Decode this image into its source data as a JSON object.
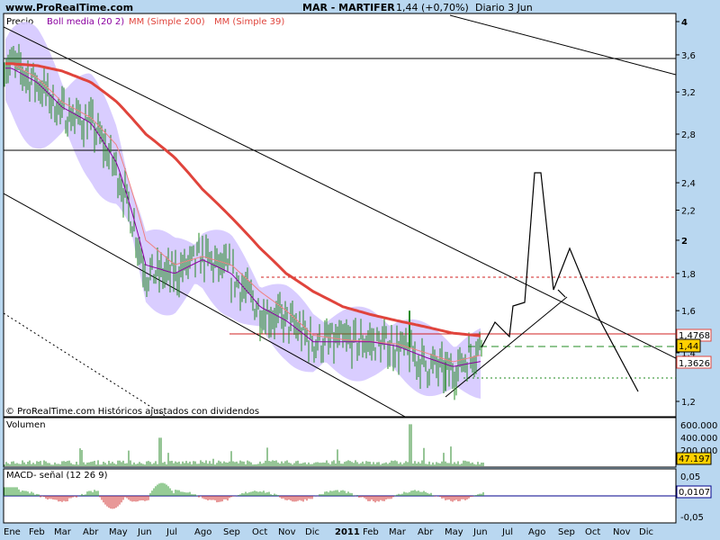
{
  "header": {
    "site": "www.ProRealTime.com",
    "instrument": "MAR - MARTIFER",
    "price_change": "1,44 (+0,70%)",
    "period": "Diario  3 Jun"
  },
  "price_panel": {
    "legend": {
      "precio": "Precio",
      "boll": "Boll media (20 2)",
      "mm200": "MM (Simple 200)",
      "mm39": "MM (Simple 39)"
    },
    "footer_note": "© ProRealTime.com Históricos ajustados con dividendos",
    "y_ticks": [
      "4",
      "3,6",
      "3,2",
      "2,8",
      "2,4",
      "2,2",
      "2",
      "1,8",
      "1,6",
      "1,4",
      "1,2"
    ],
    "price_tags": {
      "mm_value": "1,4768",
      "last": "1,44",
      "boll_value": "1,3626"
    }
  },
  "volume_panel": {
    "label": "Volumen",
    "y_ticks": [
      "600.000",
      "400.000",
      "200.000"
    ],
    "value_tag": "47.197"
  },
  "macd_panel": {
    "label": "MACD- señal (12 26 9)",
    "y_ticks": [
      "0,05",
      "-0,05"
    ],
    "value_tag": "0,0107"
  },
  "x_axis": {
    "labels": [
      "Ene",
      "Feb",
      "Mar",
      "Abr",
      "May",
      "Jun",
      "Jul",
      "Ago",
      "Sep",
      "Oct",
      "Nov",
      "Dic",
      "2011",
      "Feb",
      "Mar",
      "Abr",
      "May",
      "Jun",
      "Jul",
      "Ago",
      "Sep",
      "Oct",
      "Nov",
      "Dic"
    ]
  },
  "colors": {
    "background": "#b9d7f0",
    "plot_bg": "#ffffff",
    "price_bars": "#228b22",
    "bollinger_fill": "#d5c8ff",
    "mm200": "#e0443c",
    "mm39": "#f08080",
    "boll_mid": "#8b00a0",
    "volume_bars": "#2e8b2e",
    "macd_pos": "#2e9a2e",
    "macd_neg": "#d03030",
    "signal_line": "#00008b",
    "last_tag": "#ffd000"
  },
  "chart_data": [
    {
      "type": "line",
      "title": "MAR - MARTIFER",
      "x": [
        "Ene",
        "Feb",
        "Mar",
        "Abr",
        "May",
        "Jun",
        "Jul",
        "Ago",
        "Sep",
        "Oct",
        "Nov",
        "Dic",
        "2011",
        "Feb",
        "Mar",
        "Abr",
        "May",
        "Jun"
      ],
      "series": [
        {
          "name": "Precio",
          "values": [
            3.5,
            3.3,
            3.0,
            2.9,
            2.5,
            1.8,
            1.8,
            1.9,
            1.8,
            1.6,
            1.55,
            1.45,
            1.45,
            1.45,
            1.43,
            1.35,
            1.32,
            1.44
          ]
        },
        {
          "name": "MM (Simple 200)",
          "values": [
            3.5,
            3.48,
            3.42,
            3.3,
            3.1,
            2.8,
            2.6,
            2.35,
            2.15,
            1.95,
            1.8,
            1.7,
            1.62,
            1.58,
            1.55,
            1.52,
            1.49,
            1.4768
          ]
        },
        {
          "name": "MM (Simple 39)",
          "values": [
            3.5,
            3.35,
            3.1,
            2.95,
            2.7,
            2.0,
            1.85,
            1.9,
            1.85,
            1.7,
            1.6,
            1.48,
            1.46,
            1.45,
            1.44,
            1.4,
            1.36,
            1.39
          ]
        },
        {
          "name": "Boll media (20 2)",
          "values": [
            3.45,
            3.3,
            3.05,
            2.9,
            2.55,
            1.85,
            1.8,
            1.88,
            1.8,
            1.62,
            1.55,
            1.45,
            1.45,
            1.45,
            1.43,
            1.38,
            1.34,
            1.3626
          ]
        }
      ],
      "ylim": [
        1.1,
        4.0
      ],
      "y_scale": "log",
      "last_value": 1.44,
      "grid": false
    },
    {
      "type": "bar",
      "title": "Volumen",
      "ylim": [
        0,
        600000
      ],
      "last_value": 47197
    },
    {
      "type": "bar",
      "title": "MACD- señal (12 26 9)",
      "ylim": [
        -0.05,
        0.05
      ],
      "last_value": 0.0107
    }
  ]
}
